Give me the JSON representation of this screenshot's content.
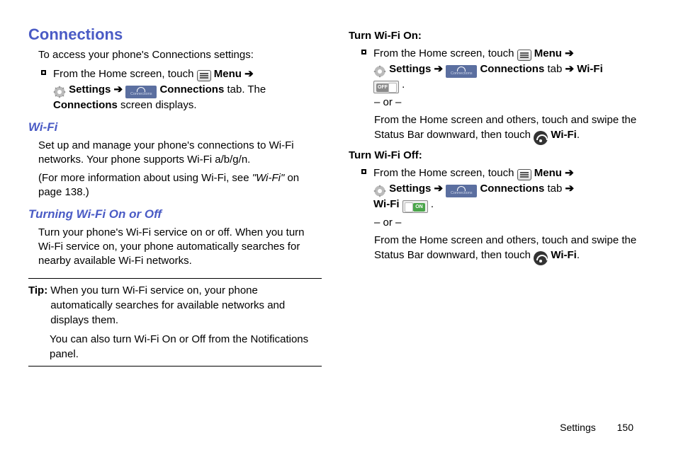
{
  "left": {
    "title": "Connections",
    "intro": "To access your phone's Connections settings:",
    "access_pre": "From the Home screen, touch ",
    "menu": "Menu",
    "arrow": "➔",
    "settings": "Settings",
    "connections": "Connections",
    "tab_text": " tab. The ",
    "connections_screen": "Connections",
    "screen_displays": " screen displays.",
    "wifi_title": "Wi-Fi",
    "wifi_p1": "Set up and manage your phone's connections to Wi-Fi networks. Your phone supports Wi-Fi a/b/g/n.",
    "wifi_p2a": "(For more information about using Wi-Fi, see ",
    "wifi_p2b": "\"Wi-Fi\"",
    "wifi_p2c": " on page 138.)",
    "turning_title": "Turning Wi-Fi On or Off",
    "turning_p": "Turn your phone's Wi-Fi service on or off. When you turn Wi-Fi service on, your phone automatically searches for nearby available Wi-Fi networks.",
    "tip_label": "Tip:",
    "tip1": "When you turn Wi-Fi service on, your phone automatically searches for available networks and displays them.",
    "tip2": "You can also turn Wi-Fi On or Off from the Notifications panel."
  },
  "right": {
    "turn_on_header": "Turn Wi-Fi On:",
    "from_home": "From the Home screen, touch ",
    "menu": "Menu",
    "arrow": "➔",
    "settings": "Settings",
    "connections": "Connections",
    "tab_text": " tab ",
    "wifi": "Wi-Fi",
    "period": ".",
    "or": "– or –",
    "alt_on": "From the Home screen and others, touch and swipe the Status Bar downward, then touch ",
    "turn_off_header": "Turn Wi-Fi Off:",
    "alt_off": "From the Home screen and others, touch and swipe the Status Bar downward, then touch "
  },
  "footer": {
    "section": "Settings",
    "page": "150"
  }
}
